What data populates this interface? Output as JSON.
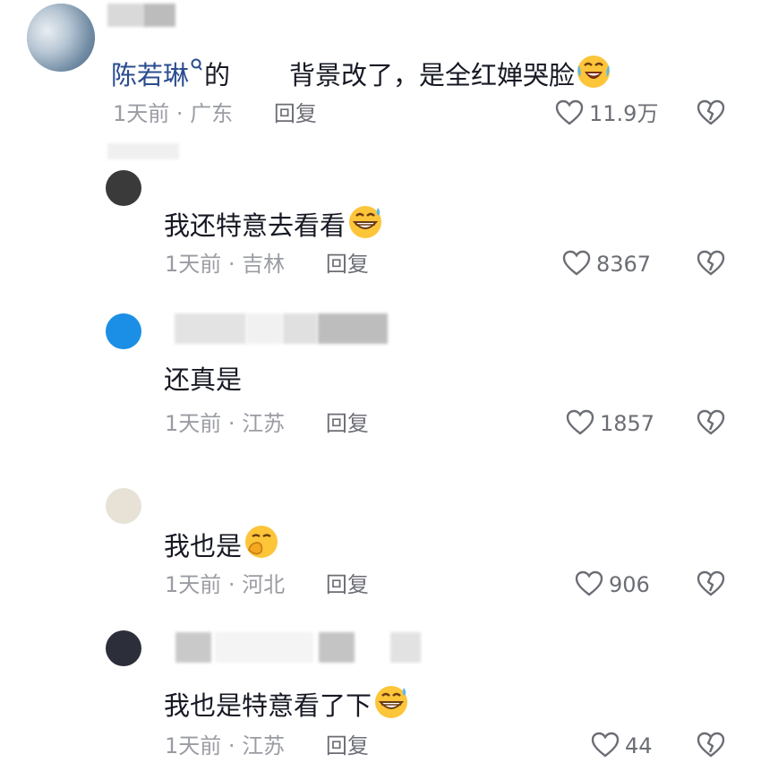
{
  "colors": {
    "mention": "#2b4d8f",
    "meta": "#9a9ca3",
    "reply": "#6c6e75",
    "text": "#161823"
  },
  "comments": [
    {
      "mention": "陈若琳",
      "text_a": "的",
      "text_b": "背景改了，是全红婵哭脸",
      "emoji": "laughing-crying-face",
      "time": "1天前",
      "location": "广东",
      "reply": "回复",
      "likes": "11.9万"
    },
    {
      "text": "我还特意去看看",
      "emoji": "grinning-sweat-face",
      "time": "1天前",
      "location": "吉林",
      "reply": "回复",
      "likes": "8367"
    },
    {
      "text": "还真是",
      "time": "1天前",
      "location": "江苏",
      "reply": "回复",
      "likes": "1857"
    },
    {
      "text": "我也是",
      "emoji": "face-with-hand-over-mouth",
      "time": "1天前",
      "location": "河北",
      "reply": "回复",
      "likes": "906"
    },
    {
      "text": "我也是特意看了下",
      "emoji": "grinning-sweat-face",
      "time": "1天前",
      "location": "江苏",
      "reply": "回复",
      "likes": "44"
    }
  ]
}
